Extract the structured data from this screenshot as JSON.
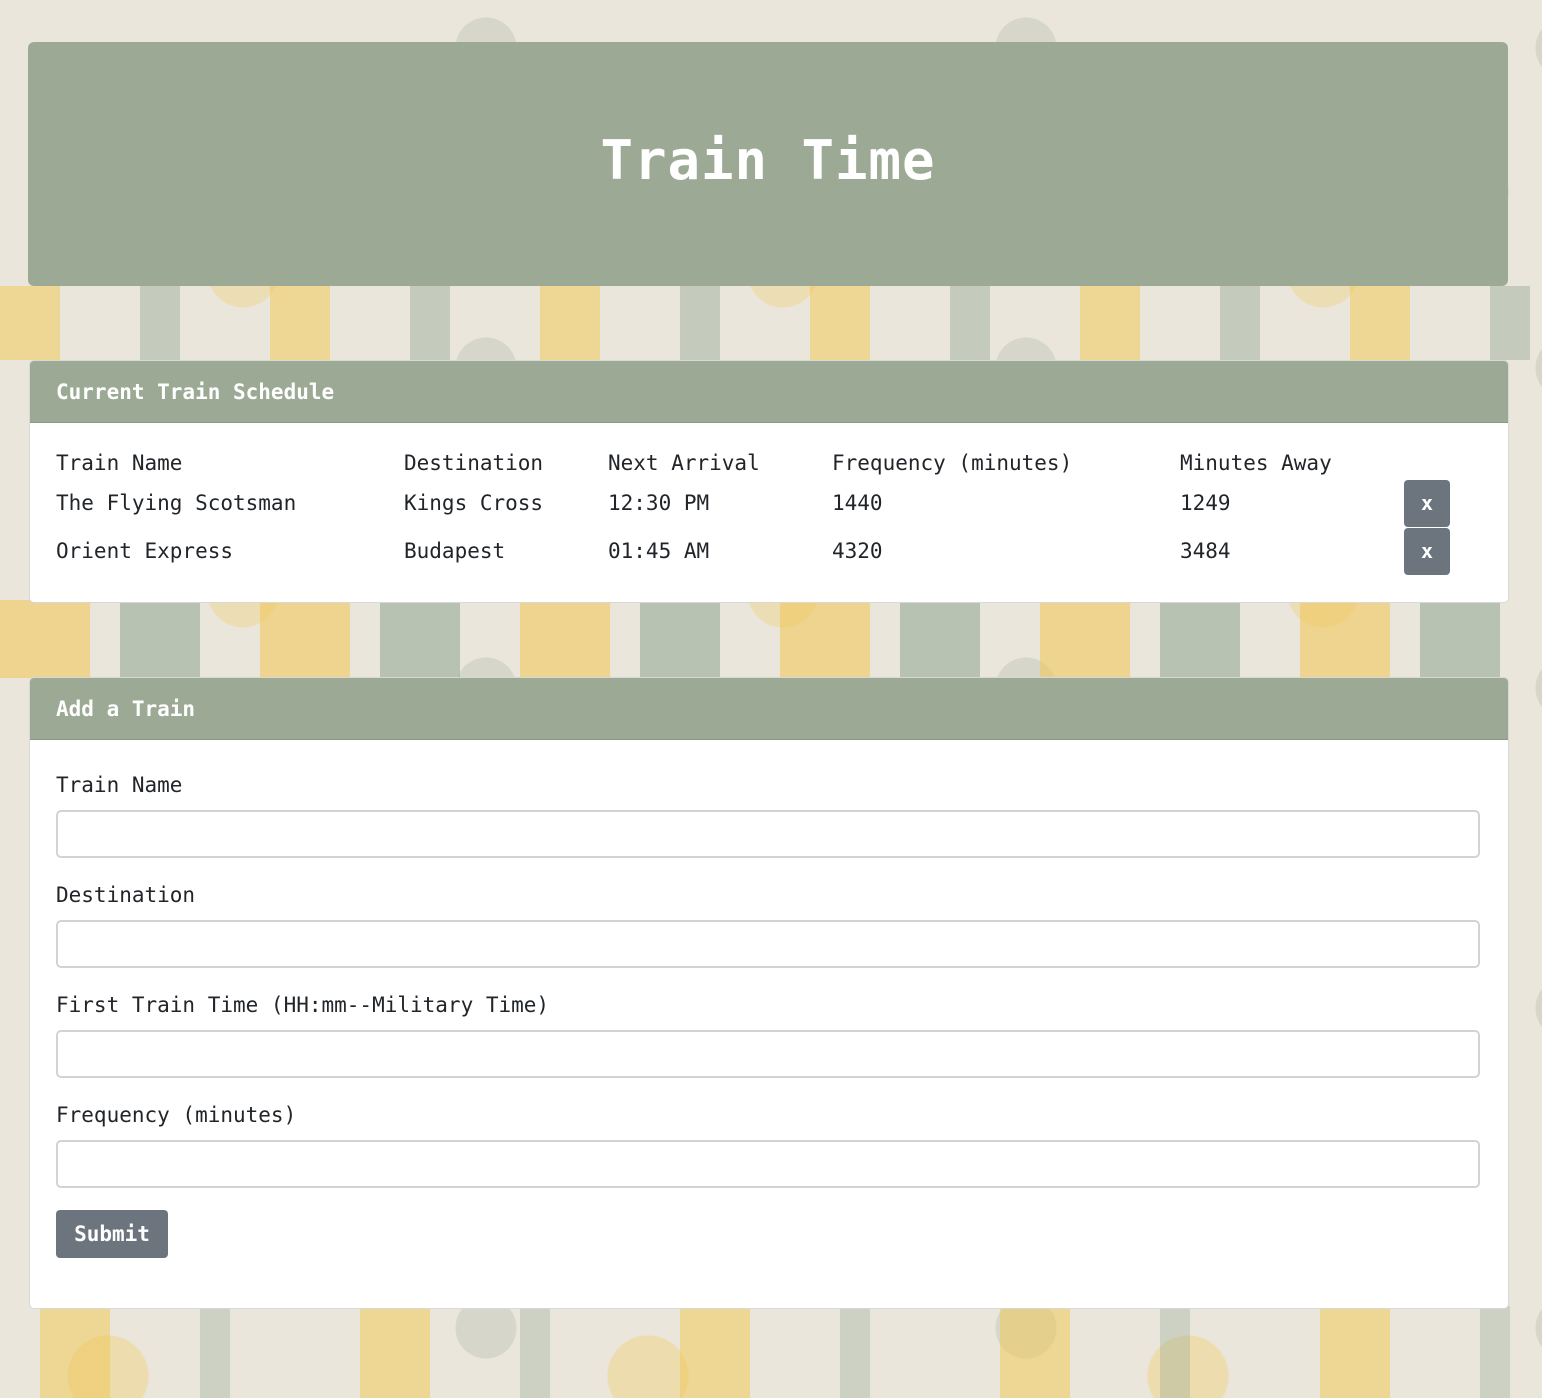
{
  "header": {
    "title": "Train Time"
  },
  "schedule": {
    "title": "Current Train Schedule",
    "columns": {
      "name": "Train Name",
      "destination": "Destination",
      "next_arrival": "Next Arrival",
      "frequency": "Frequency (minutes)",
      "minutes_away": "Minutes Away"
    },
    "rows": [
      {
        "name": "The Flying Scotsman",
        "destination": "Kings Cross",
        "next_arrival": "12:30 PM",
        "frequency": "1440",
        "minutes_away": "1249",
        "delete_label": "x"
      },
      {
        "name": "Orient Express",
        "destination": "Budapest",
        "next_arrival": "01:45 AM",
        "frequency": "4320",
        "minutes_away": "3484",
        "delete_label": "x"
      }
    ]
  },
  "add_train": {
    "title": "Add a Train",
    "fields": {
      "train_name": {
        "label": "Train Name",
        "value": "",
        "placeholder": ""
      },
      "destination": {
        "label": "Destination",
        "value": "",
        "placeholder": ""
      },
      "first_time": {
        "label": "First Train Time (HH:mm--Military Time)",
        "value": "",
        "placeholder": ""
      },
      "frequency": {
        "label": "Frequency (minutes)",
        "value": "",
        "placeholder": ""
      }
    },
    "submit_label": "Submit"
  },
  "colors": {
    "header_green": "#9caa95",
    "button_gray": "#6c757d",
    "card_bg": "#ffffff"
  }
}
